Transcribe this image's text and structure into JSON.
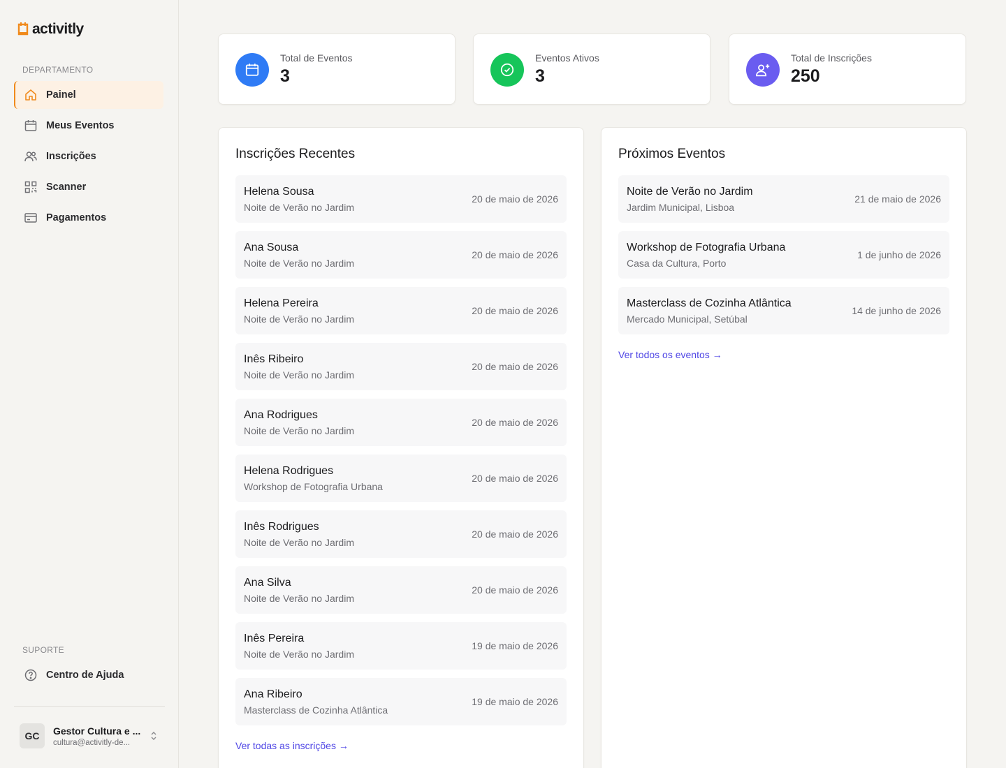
{
  "brand": {
    "name": "activitly",
    "accent": "#f08a1c"
  },
  "sidebar": {
    "section_main": "DEPARTAMENTO",
    "items": [
      {
        "label": "Painel",
        "icon": "home-icon",
        "active": true
      },
      {
        "label": "Meus Eventos",
        "icon": "calendar-icon"
      },
      {
        "label": "Inscrições",
        "icon": "users-icon"
      },
      {
        "label": "Scanner",
        "icon": "qr-code-icon"
      },
      {
        "label": "Pagamentos",
        "icon": "credit-card-icon"
      }
    ],
    "section_support": "SUPORTE",
    "support_item": {
      "label": "Centro de Ajuda",
      "icon": "help-circle-icon"
    },
    "user": {
      "initials": "GC",
      "name": "Gestor Cultura e ...",
      "email": "cultura@activitly-de..."
    }
  },
  "stats": [
    {
      "label": "Total de Eventos",
      "value": "3",
      "icon": "calendar-icon",
      "color": "#2f7bf5"
    },
    {
      "label": "Eventos Ativos",
      "value": "3",
      "icon": "check-circle-icon",
      "color": "#16c55a"
    },
    {
      "label": "Total de Inscrições",
      "value": "250",
      "icon": "user-plus-icon",
      "color": "#6a5cf0"
    }
  ],
  "recent": {
    "title": "Inscrições Recentes",
    "rows": [
      {
        "name": "Helena Sousa",
        "event": "Noite de Verão no Jardim",
        "date": "20 de maio de 2026"
      },
      {
        "name": "Ana Sousa",
        "event": "Noite de Verão no Jardim",
        "date": "20 de maio de 2026"
      },
      {
        "name": "Helena Pereira",
        "event": "Noite de Verão no Jardim",
        "date": "20 de maio de 2026"
      },
      {
        "name": "Inês Ribeiro",
        "event": "Noite de Verão no Jardim",
        "date": "20 de maio de 2026"
      },
      {
        "name": "Ana Rodrigues",
        "event": "Noite de Verão no Jardim",
        "date": "20 de maio de 2026"
      },
      {
        "name": "Helena Rodrigues",
        "event": "Workshop de Fotografia Urbana",
        "date": "20 de maio de 2026"
      },
      {
        "name": "Inês Rodrigues",
        "event": "Noite de Verão no Jardim",
        "date": "20 de maio de 2026"
      },
      {
        "name": "Ana Silva",
        "event": "Noite de Verão no Jardim",
        "date": "20 de maio de 2026"
      },
      {
        "name": "Inês Pereira",
        "event": "Noite de Verão no Jardim",
        "date": "19 de maio de 2026"
      },
      {
        "name": "Ana Ribeiro",
        "event": "Masterclass de Cozinha Atlântica",
        "date": "19 de maio de 2026"
      }
    ],
    "link": "Ver todas as inscrições →"
  },
  "upcoming": {
    "title": "Próximos Eventos",
    "rows": [
      {
        "name": "Noite de Verão no Jardim",
        "place": "Jardim Municipal, Lisboa",
        "date": "21 de maio de 2026"
      },
      {
        "name": "Workshop de Fotografia Urbana",
        "place": "Casa da Cultura, Porto",
        "date": "1 de junho de 2026"
      },
      {
        "name": "Masterclass de Cozinha Atlântica",
        "place": "Mercado Municipal, Setúbal",
        "date": "14 de junho de 2026"
      }
    ],
    "link": "Ver todos os eventos →"
  }
}
